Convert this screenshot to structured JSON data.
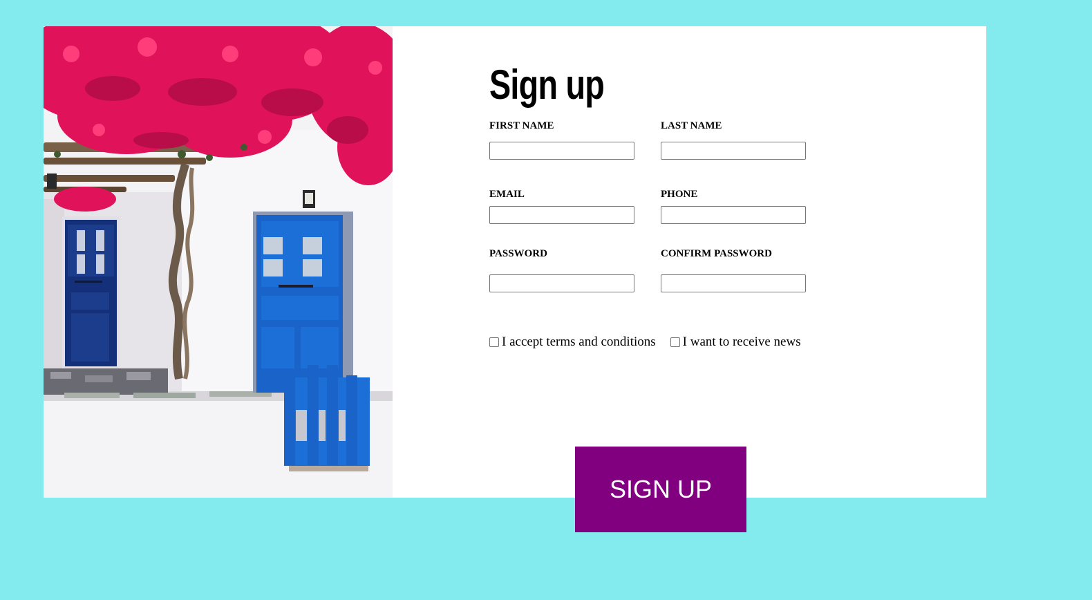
{
  "form": {
    "title": "Sign up",
    "first_name_label": "FIRST NAME",
    "last_name_label": "LAST NAME",
    "email_label": "EMAIL",
    "phone_label": "PHONE",
    "password_label": "PASSWORD",
    "confirm_password_label": "CONFIRM PASSWORD",
    "first_name_value": "",
    "last_name_value": "",
    "email_value": "",
    "phone_value": "",
    "password_value": "",
    "confirm_password_value": "",
    "terms_label": "I accept terms and conditions",
    "terms_checked": false,
    "news_label": "I want to receive news",
    "news_checked": false,
    "submit_label": "SIGN UP"
  },
  "photo": {
    "subject": "whitewashed house with blue doors and pink bougainvillea"
  },
  "colors": {
    "page_background": "#83eaee",
    "card_background": "#ffffff",
    "button_background": "#800080",
    "button_text": "#ffffff",
    "door_blue": "#1a63c9",
    "flower_pink": "#e0125a"
  }
}
